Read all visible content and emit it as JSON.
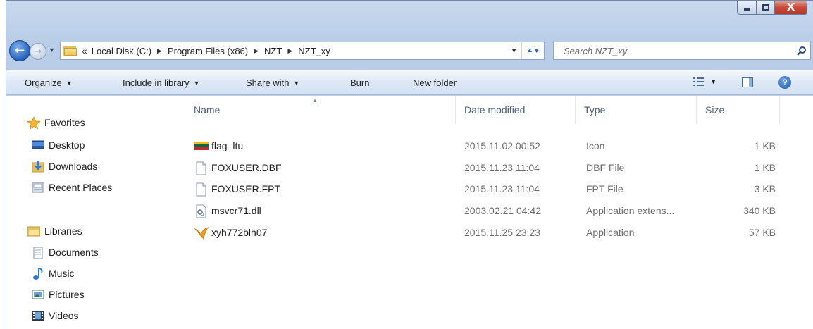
{
  "window": {
    "minimize_label": "minimize",
    "maximize_label": "maximize",
    "close_glyph": "X"
  },
  "address": {
    "overflow": "«",
    "crumbs": [
      "Local Disk (C:)",
      "Program Files (x86)",
      "NZT",
      "NZT_xy"
    ],
    "separator": "▶"
  },
  "search": {
    "placeholder": "Search NZT_xy"
  },
  "toolbar": {
    "organize": "Organize",
    "include_in_library": "Include in library",
    "share_with": "Share with",
    "burn": "Burn",
    "new_folder": "New folder"
  },
  "sidebar": {
    "favorites": "Favorites",
    "desktop": "Desktop",
    "downloads": "Downloads",
    "recent_places": "Recent Places",
    "libraries": "Libraries",
    "documents": "Documents",
    "music": "Music",
    "pictures": "Pictures",
    "videos": "Videos"
  },
  "columns": {
    "name": "Name",
    "date_modified": "Date modified",
    "type": "Type",
    "size": "Size"
  },
  "files": [
    {
      "name": "flag_ltu",
      "date": "2015.11.02 00:52",
      "type": "Icon",
      "size": "1 KB",
      "icon": "flag-icon"
    },
    {
      "name": "FOXUSER.DBF",
      "date": "2015.11.23 11:04",
      "type": "DBF File",
      "size": "1 KB",
      "icon": "blank-file-icon"
    },
    {
      "name": "FOXUSER.FPT",
      "date": "2015.11.23 11:04",
      "type": "FPT File",
      "size": "3 KB",
      "icon": "blank-file-icon"
    },
    {
      "name": "msvcr71.dll",
      "date": "2003.02.21 04:42",
      "type": "Application extens...",
      "size": "340 KB",
      "icon": "dll-icon"
    },
    {
      "name": "xyh772blh07",
      "date": "2015.11.25 23:23",
      "type": "Application",
      "size": "57 KB",
      "icon": "fox-app-icon"
    }
  ]
}
